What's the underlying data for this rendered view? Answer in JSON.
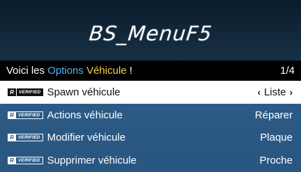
{
  "banner": {
    "title": "BS_MenuF5"
  },
  "subheader": {
    "text_prefix": "Voici les ",
    "text_highlight_1": "Options",
    "text_space": " ",
    "text_highlight_2": "Véhicule",
    "text_suffix": " !",
    "counter": "1/4"
  },
  "badge": {
    "r_label": "R",
    "verified_label": "VERIFIED"
  },
  "items": [
    {
      "label": "Spawn véhicule",
      "value": "Liste",
      "arrow_left": "‹",
      "arrow_right": "›"
    },
    {
      "label": "Actions véhicule",
      "value": "Réparer"
    },
    {
      "label": "Modifier véhicule",
      "value": "Plaque"
    },
    {
      "label": "Supprimer véhicule",
      "value": "Proche"
    }
  ],
  "colors": {
    "banner_bg": "#0b1c2b",
    "item_bg": "#2e5d88",
    "selected_bg": "#ffffff",
    "highlight_blue": "#52b4ee",
    "highlight_yellow": "#f5cf46"
  }
}
